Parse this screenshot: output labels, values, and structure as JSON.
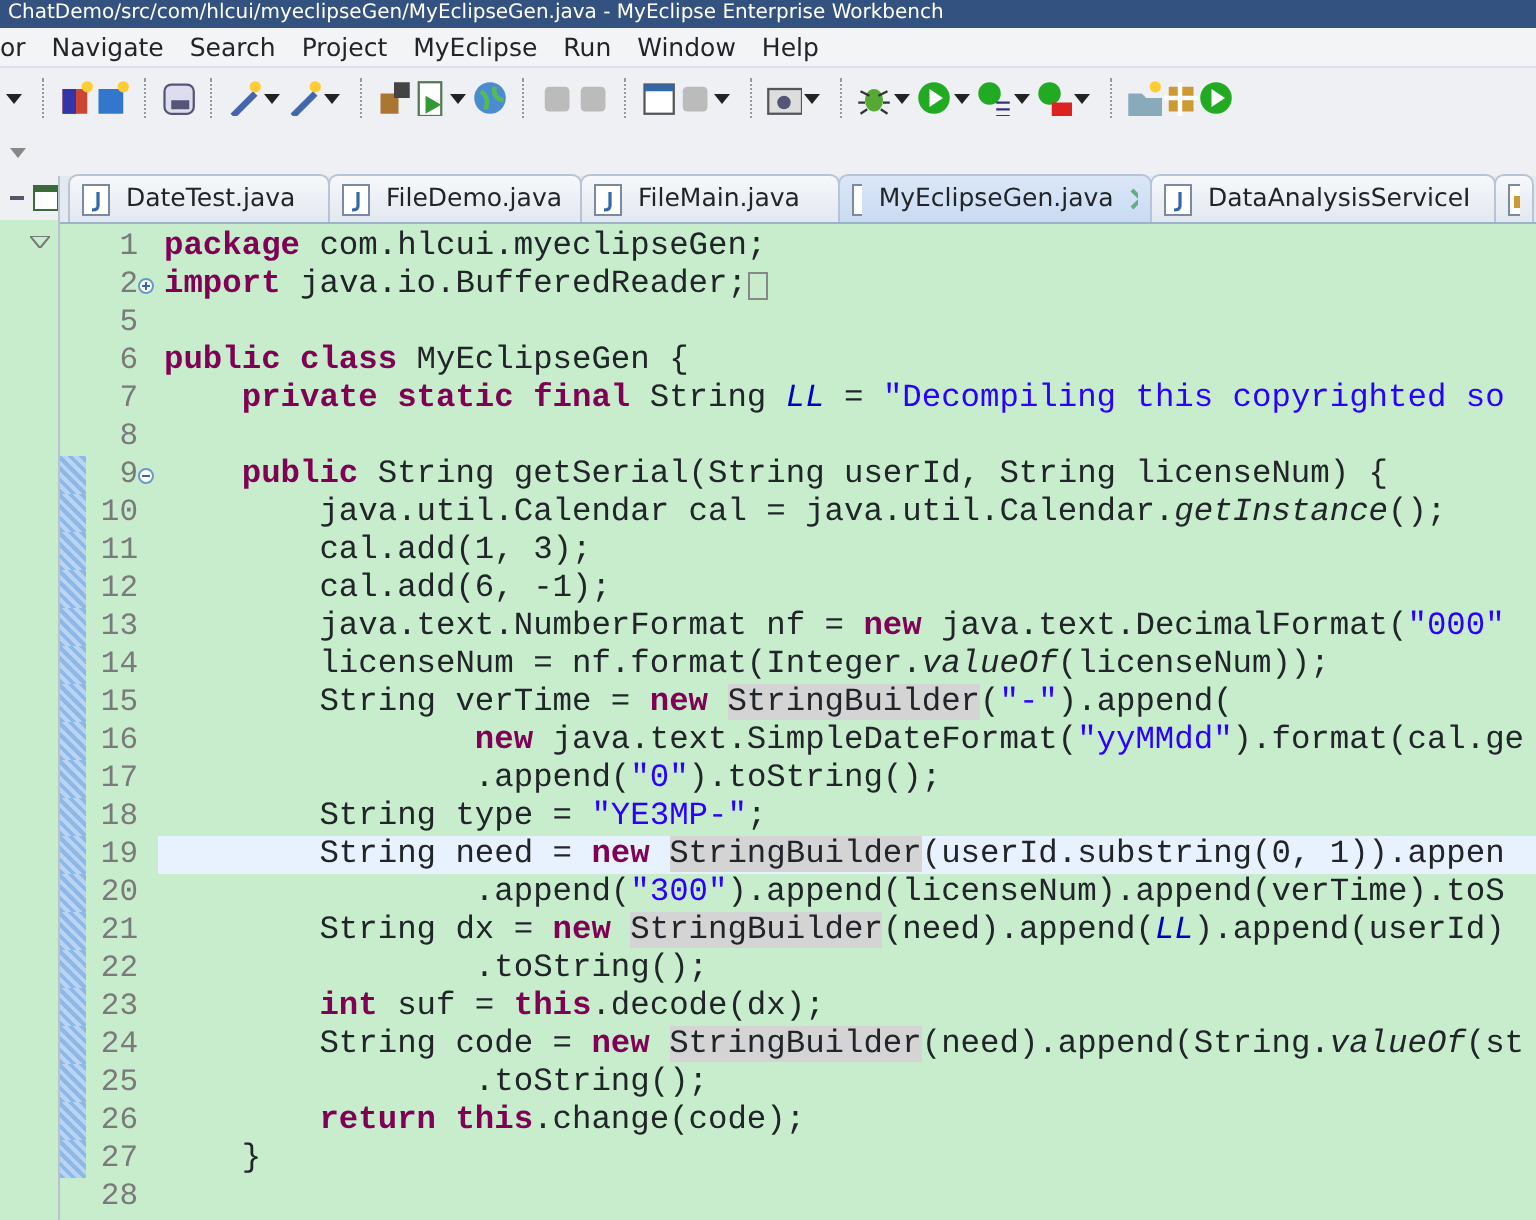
{
  "window": {
    "title": "ChatDemo/src/com/hlcui/myeclipseGen/MyEclipseGen.java - MyEclipse Enterprise Workbench"
  },
  "menu": [
    "or",
    "Navigate",
    "Search",
    "Project",
    "MyEclipse",
    "Run",
    "Window",
    "Help"
  ],
  "tabs": [
    {
      "label": "DateTest.java",
      "selected": false
    },
    {
      "label": "FileDemo.java",
      "selected": false
    },
    {
      "label": "FileMain.java",
      "selected": false
    },
    {
      "label": "MyEclipseGen.java",
      "selected": true
    },
    {
      "label": "DataAnalysisServiceI",
      "selected": false
    }
  ],
  "editor": {
    "lines": [
      {
        "number": "1",
        "changed": false,
        "current": false,
        "segments": [
          {
            "kind": "keyword",
            "text": "package"
          },
          {
            "kind": "plain",
            "text": " com.hlcui.myeclipseGen;"
          }
        ]
      },
      {
        "number": "2",
        "changed": false,
        "current": false,
        "collapsed": true,
        "segments": [
          {
            "kind": "keyword",
            "text": "import"
          },
          {
            "kind": "plain",
            "text": " java.io.BufferedReader;"
          }
        ]
      },
      {
        "number": "5",
        "changed": false,
        "current": false
      },
      {
        "number": "6",
        "changed": false,
        "current": false,
        "segments": [
          {
            "kind": "keyword",
            "text": "public class"
          },
          {
            "kind": "plain",
            "text": " MyEclipseGen {"
          }
        ]
      },
      {
        "number": "7",
        "changed": false,
        "current": false,
        "segments": [
          {
            "kind": "keyword",
            "text": "    private static final"
          },
          {
            "kind": "plain",
            "text": " String "
          },
          {
            "kind": "field",
            "text": "LL"
          },
          {
            "kind": "plain",
            "text": " = "
          },
          {
            "kind": "string",
            "text": "\"Decompiling this copyrighted so"
          }
        ]
      },
      {
        "number": "8",
        "changed": false,
        "current": false
      },
      {
        "number": "9",
        "changed": true,
        "current": false,
        "collapsed": false,
        "segments": [
          {
            "kind": "keyword",
            "text": "    public"
          },
          {
            "kind": "plain",
            "text": " String getSerial(String userId, String licenseNum) {"
          }
        ]
      },
      {
        "number": "10",
        "changed": true,
        "current": false,
        "segments": [
          {
            "kind": "plain",
            "text": "        java.util.Calendar cal = java.util.Calendar."
          },
          {
            "kind": "method",
            "text": "getInstance"
          },
          {
            "kind": "plain",
            "text": "();"
          }
        ]
      },
      {
        "number": "11",
        "changed": true,
        "current": false,
        "segments": [
          {
            "kind": "plain",
            "text": "        cal.add(1, 3);"
          }
        ]
      },
      {
        "number": "12",
        "changed": true,
        "current": false,
        "segments": [
          {
            "kind": "plain",
            "text": "        cal.add(6, -1);"
          }
        ]
      },
      {
        "number": "13",
        "changed": true,
        "current": false,
        "segments": [
          {
            "kind": "plain",
            "text": "        java.text.NumberFormat nf = "
          },
          {
            "kind": "keyword",
            "text": "new"
          },
          {
            "kind": "plain",
            "text": " java.text.DecimalFormat("
          },
          {
            "kind": "string",
            "text": "\"000\""
          }
        ]
      },
      {
        "number": "14",
        "changed": true,
        "current": false,
        "segments": [
          {
            "kind": "plain",
            "text": "        licenseNum = nf.format(Integer."
          },
          {
            "kind": "method",
            "text": "valueOf"
          },
          {
            "kind": "plain",
            "text": "(licenseNum));"
          }
        ]
      },
      {
        "number": "15",
        "changed": true,
        "current": false,
        "segments": [
          {
            "kind": "plain",
            "text": "        String verTime = "
          },
          {
            "kind": "keyword",
            "text": "new "
          },
          {
            "kind": "occurrence",
            "text": "StringBuilder"
          },
          {
            "kind": "plain",
            "text": "("
          },
          {
            "kind": "string",
            "text": "\"-\""
          },
          {
            "kind": "plain",
            "text": ").append("
          }
        ]
      },
      {
        "number": "16",
        "changed": true,
        "current": false,
        "segments": [
          {
            "kind": "keyword",
            "text": "                new"
          },
          {
            "kind": "plain",
            "text": " java.text.SimpleDateFormat("
          },
          {
            "kind": "string",
            "text": "\"yyMMdd\""
          },
          {
            "kind": "plain",
            "text": ").format(cal.ge"
          }
        ]
      },
      {
        "number": "17",
        "changed": true,
        "current": false,
        "segments": [
          {
            "kind": "plain",
            "text": "                .append("
          },
          {
            "kind": "string",
            "text": "\"0\""
          },
          {
            "kind": "plain",
            "text": ").toString();"
          }
        ]
      },
      {
        "number": "18",
        "changed": true,
        "current": false,
        "segments": [
          {
            "kind": "plain",
            "text": "        String type = "
          },
          {
            "kind": "string",
            "text": "\"YE3MP-\""
          },
          {
            "kind": "plain",
            "text": ";"
          }
        ]
      },
      {
        "number": "19",
        "changed": true,
        "current": true,
        "segments": [
          {
            "kind": "plain",
            "text": "        String need = "
          },
          {
            "kind": "keyword",
            "text": "new "
          },
          {
            "kind": "occurrence",
            "text": "StringBuilder"
          },
          {
            "kind": "plain",
            "text": "(userId.substring(0, 1)).appen"
          }
        ]
      },
      {
        "number": "20",
        "changed": true,
        "current": false,
        "segments": [
          {
            "kind": "plain",
            "text": "                .append("
          },
          {
            "kind": "string",
            "text": "\"300\""
          },
          {
            "kind": "plain",
            "text": ").append(licenseNum).append(verTime).toS"
          }
        ]
      },
      {
        "number": "21",
        "changed": true,
        "current": false,
        "segments": [
          {
            "kind": "plain",
            "text": "        String dx = "
          },
          {
            "kind": "keyword",
            "text": "new "
          },
          {
            "kind": "occurrence",
            "text": "StringBuilder"
          },
          {
            "kind": "plain",
            "text": "(need).append("
          },
          {
            "kind": "field",
            "text": "LL"
          },
          {
            "kind": "plain",
            "text": ").append(userId)"
          }
        ]
      },
      {
        "number": "22",
        "changed": true,
        "current": false,
        "segments": [
          {
            "kind": "plain",
            "text": "                .toString();"
          }
        ]
      },
      {
        "number": "23",
        "changed": true,
        "current": false,
        "segments": [
          {
            "kind": "keyword",
            "text": "        int"
          },
          {
            "kind": "plain",
            "text": " suf = "
          },
          {
            "kind": "keyword",
            "text": "this"
          },
          {
            "kind": "plain",
            "text": ".decode(dx);"
          }
        ]
      },
      {
        "number": "24",
        "changed": true,
        "current": false,
        "segments": [
          {
            "kind": "plain",
            "text": "        String code = "
          },
          {
            "kind": "keyword",
            "text": "new "
          },
          {
            "kind": "occurrence",
            "text": "StringBuilder"
          },
          {
            "kind": "plain",
            "text": "(need).append(String."
          },
          {
            "kind": "method",
            "text": "valueOf"
          },
          {
            "kind": "plain",
            "text": "(st"
          }
        ]
      },
      {
        "number": "25",
        "changed": true,
        "current": false,
        "segments": [
          {
            "kind": "plain",
            "text": "                .toString();"
          }
        ]
      },
      {
        "number": "26",
        "changed": true,
        "current": false,
        "segments": [
          {
            "kind": "keyword",
            "text": "        return this"
          },
          {
            "kind": "plain",
            "text": ".change(code);"
          }
        ]
      },
      {
        "number": "27",
        "changed": true,
        "current": false,
        "segments": [
          {
            "kind": "plain",
            "text": "    }"
          }
        ]
      },
      {
        "number": "28",
        "changed": false,
        "current": false
      }
    ]
  }
}
